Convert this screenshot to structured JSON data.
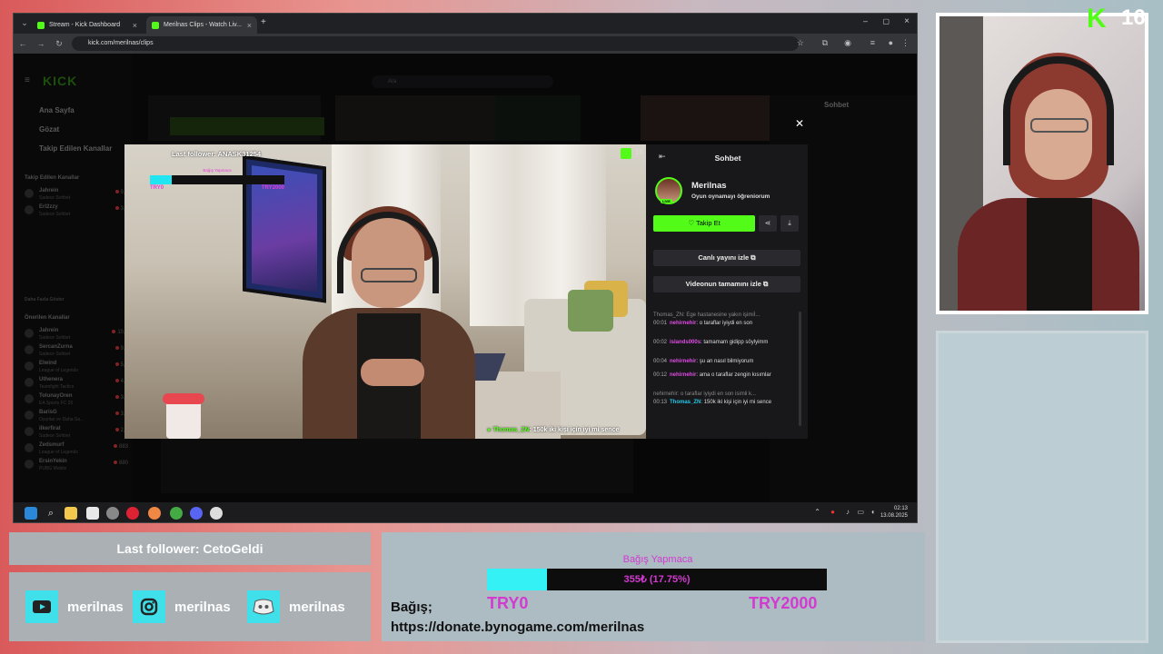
{
  "browser": {
    "tabs": [
      {
        "label": "Stream - Kick Dashboard",
        "active": false
      },
      {
        "label": "Merilnas Clips - Watch Liv...",
        "active": true
      }
    ],
    "url": "kick.com/merilnas/clips"
  },
  "sidebar": {
    "nav": [
      "Ana Sayfa",
      "Gözat",
      "Takip Edilen Kanallar"
    ],
    "followed_header": "Takip Edilen Kanallar",
    "followed": [
      {
        "name": "Jahrein",
        "game": "Sadece Sohbet",
        "count": "9,8"
      },
      {
        "name": "Erl2zzy",
        "game": "Sadece Sohbet",
        "count": "3,8"
      }
    ],
    "show_more": "Daha Fazla Göster",
    "recommended_header": "Önerilen Kanallar",
    "recommended": [
      {
        "name": "Jahrein",
        "game": "Sadece Sohbet",
        "count": "10,0"
      },
      {
        "name": "SercanZurna",
        "game": "Sadece Sohbet",
        "count": "9,1"
      },
      {
        "name": "Elwind",
        "game": "League of Legends",
        "count": "5,3"
      },
      {
        "name": "Uthenera",
        "game": "Teamfight Tactics",
        "count": "4,8"
      },
      {
        "name": "TolunayOren",
        "game": "EA Sports FC 25",
        "count": "3,9"
      },
      {
        "name": "BarisG",
        "game": "Oyunlar ve Daha Sa...",
        "count": "3,6"
      },
      {
        "name": "ilkerfirat",
        "game": "Sadece Sohbet",
        "count": "2,8"
      },
      {
        "name": "Zedsmurf",
        "game": "League of Legends",
        "count": "883"
      },
      {
        "name": "ErsinYekin",
        "game": "PUBG Mobile",
        "count": "880"
      }
    ]
  },
  "search": {
    "placeholder": "Ara"
  },
  "video_overlay": {
    "last_follower": "Last follower: ANASK31254",
    "kick_count": "16",
    "bar_label": "Bağış Yapmaca",
    "bar_min": "TRY0",
    "bar_max": "TRY2000",
    "bar_value": "355₺ (17.75%)",
    "chat_user": "Thomas_ZN",
    "chat_text": ": 150k iki kişi için iyi mi sence"
  },
  "clip_chat": {
    "title": "Sohbet",
    "streamer": "Merilnas",
    "status": "Oyun oynamayı öğreniorum",
    "live_badge": "LIVE",
    "follow_label": "Takip Et",
    "watch_live": "Canlı yayını izle",
    "watch_full": "Videonun tamamını izle",
    "messages": [
      {
        "reply": "Thomas_ZN: Ege hastanesine yakın işimiİ...",
        "ts": "00:01",
        "user": "nehirnehir",
        "color": "#e04ce4",
        "text": ": o taraflar iyiydi en son"
      },
      {
        "ts": "00:02",
        "user": "islands000s",
        "color": "#e04ce4",
        "text": ": tamamam gidipp söylyimm"
      },
      {
        "ts": "00:04",
        "user": "nehirnehir",
        "color": "#e04ce4",
        "text": ": şu an nasıl bilmiyorum"
      },
      {
        "ts": "00:12",
        "user": "nehirnehir",
        "color": "#e04ce4",
        "text": ": ama o taraflar zengin kısımlar"
      },
      {
        "reply": "nehirnehir: o taraflar iyiydi en son isimli k...",
        "ts": "00:13",
        "user": "Thomas_ZN",
        "color": "#21c8e8",
        "text": ": 150k iki kişi için iyi mi sence"
      }
    ]
  },
  "taskbar": {
    "time": "02:13",
    "date": "13.08.2025"
  },
  "right_overlay": {
    "kick_count": "16"
  },
  "bottom": {
    "last_follower": "Last follower: CetoGeldi",
    "socials": [
      {
        "icon": "youtube-icon",
        "label": "merilnas"
      },
      {
        "icon": "instagram-icon",
        "label": "merilnas"
      },
      {
        "icon": "discord-icon",
        "label": "merilnas"
      }
    ],
    "donation": {
      "title": "Bağış Yapmaca",
      "amount": "355₺ (17.75%)",
      "progress_fraction": 0.1775,
      "min": "TRY0",
      "max": "TRY2000",
      "label": "Bağış;",
      "url": "https://donate.bynogame.com/merilnas"
    }
  },
  "colors": {
    "kick_green": "#53fc18",
    "donation_magenta": "#d23ad0",
    "cyan": "#34f1f5"
  }
}
